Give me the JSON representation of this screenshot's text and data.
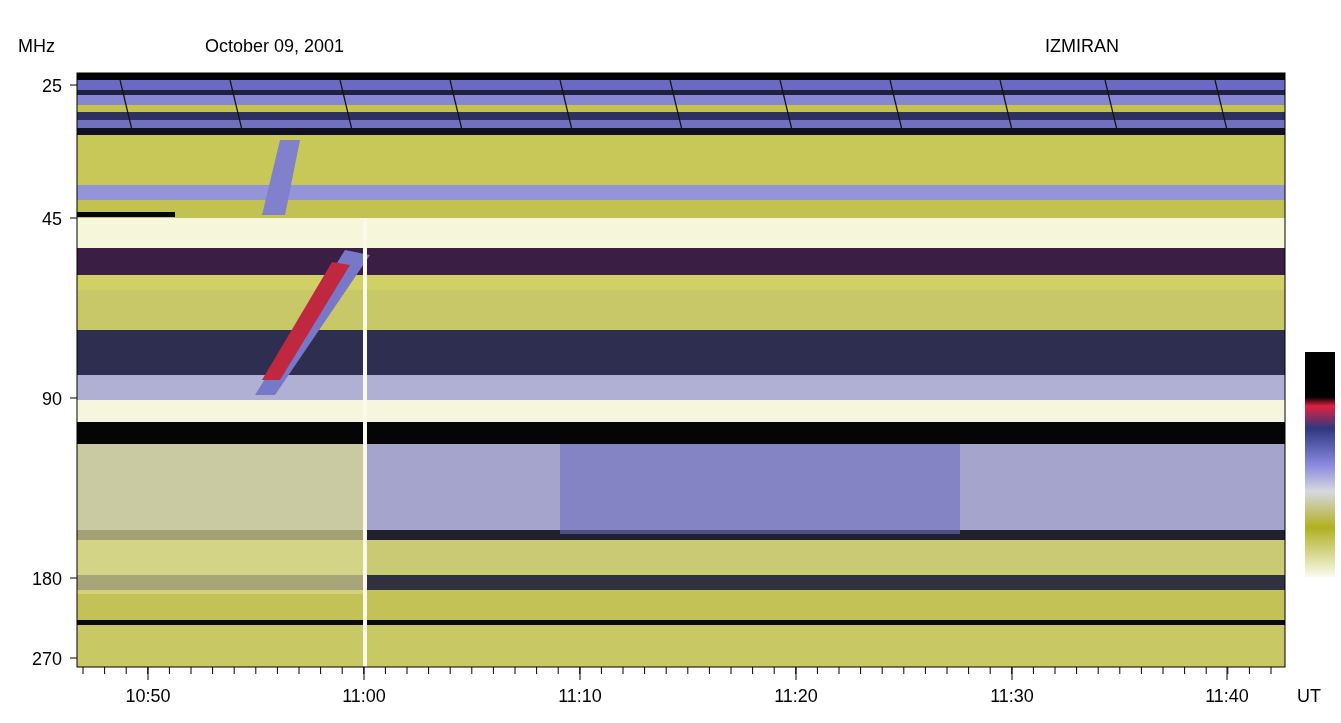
{
  "header": {
    "unit": "MHz",
    "date": "October 09, 2001",
    "observatory": "IZMIRAN"
  },
  "y_axis": {
    "labels": [
      "25",
      "45",
      "90",
      "180",
      "270"
    ]
  },
  "x_axis": {
    "labels": [
      "10:50",
      "11:00",
      "11:10",
      "11:20",
      "11:30",
      "11:40"
    ],
    "unit": "UT"
  }
}
